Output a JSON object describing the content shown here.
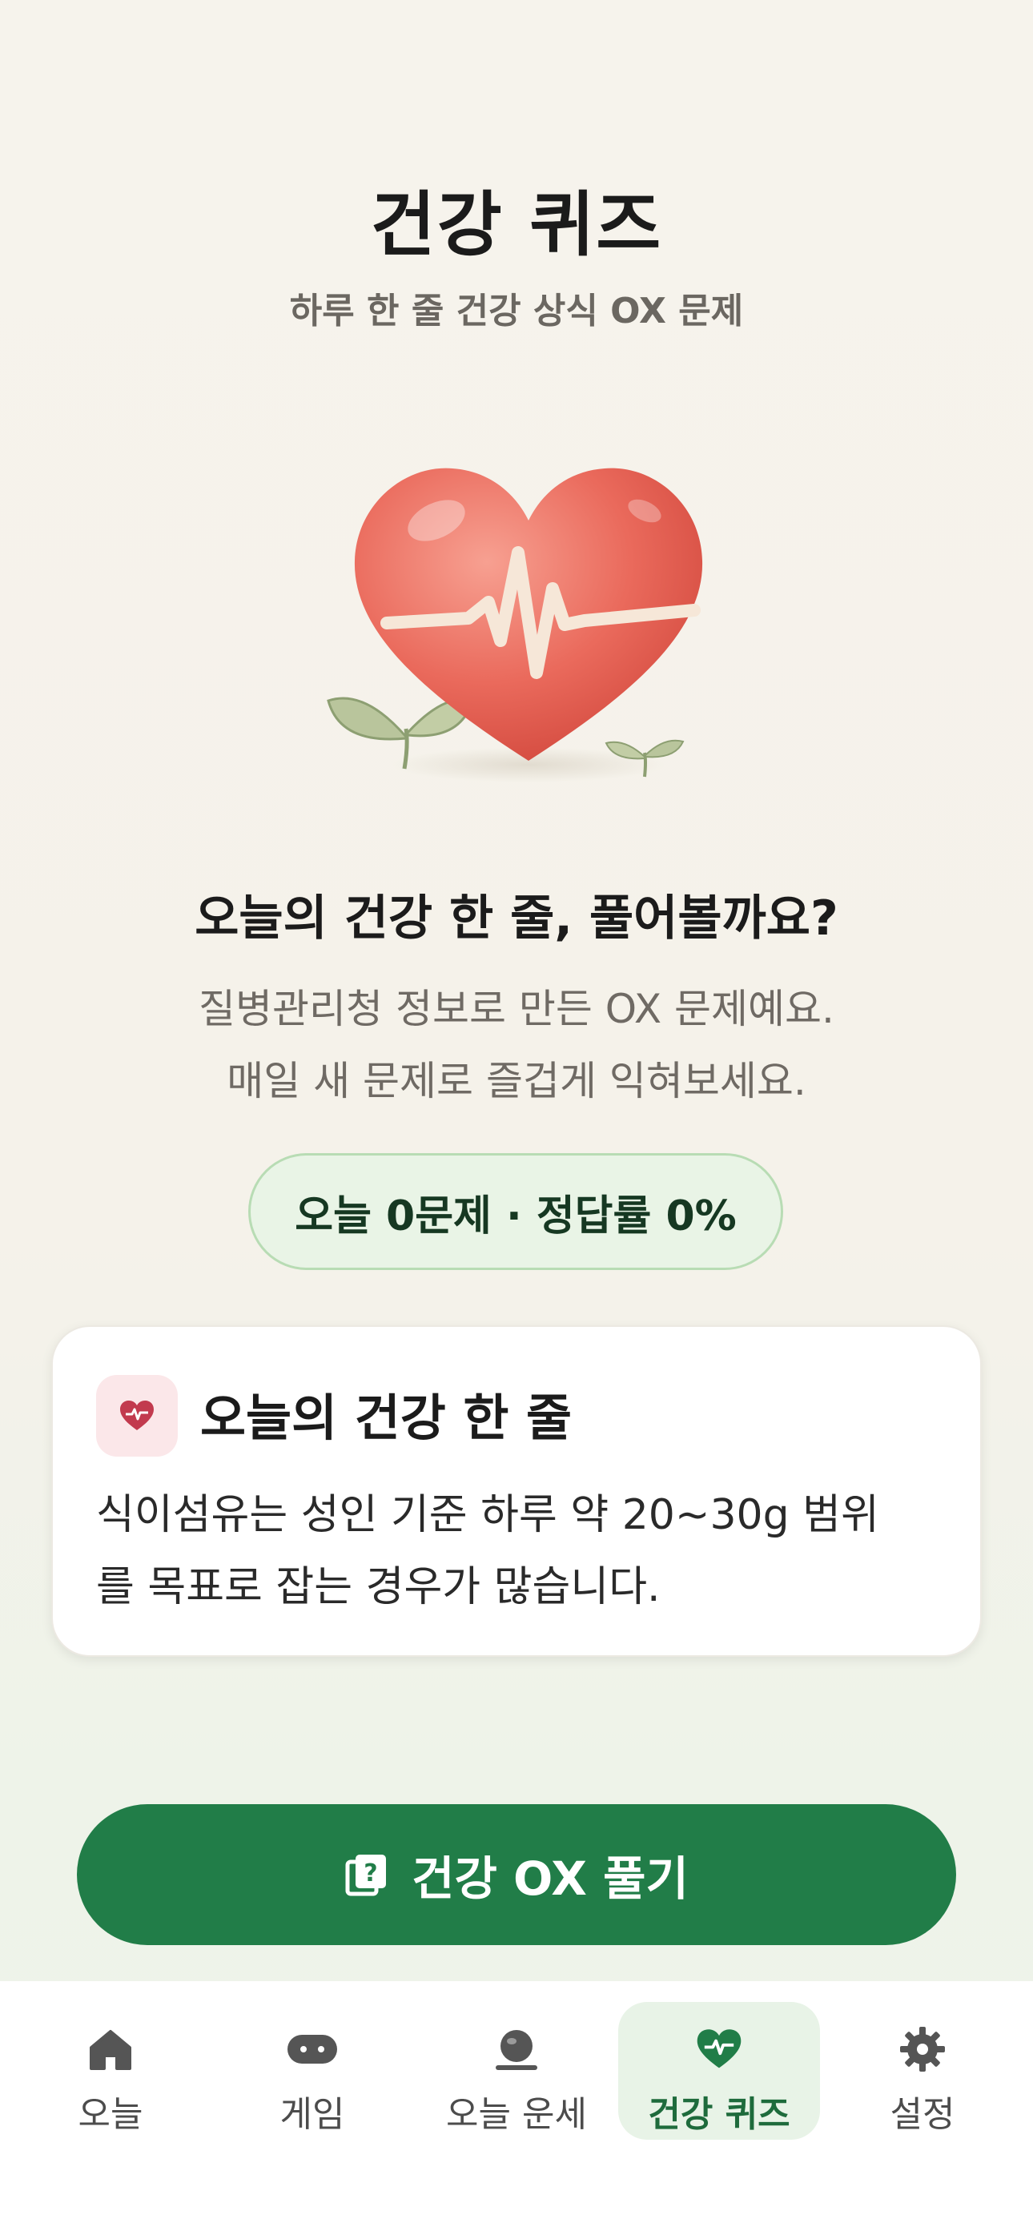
{
  "header": {
    "title": "건강 퀴즈",
    "subtitle": "하루 한 줄 건강 상식 OX 문제"
  },
  "hero": {
    "image": "heart-with-heartbeat-line-and-sprouts"
  },
  "intro": {
    "headline": "오늘의 건강 한 줄, 풀어볼까요?",
    "description_lines": [
      "질병관리청 정보로 만든 OX 문제예요.",
      "매일 새 문제로 즐겁게 익혀보세요."
    ]
  },
  "stats": {
    "text": "오늘 0문제 · 정답률 0%"
  },
  "tip_card": {
    "icon": "heart-pulse-icon",
    "title": "오늘의 건강 한 줄",
    "body_lines": [
      "식이섬유는 성인 기준 하루 약 20~30g 범위",
      "를 목표로 잡는 경우가 많습니다."
    ]
  },
  "cta": {
    "label": "건강 OX 풀기",
    "icon": "quiz-question-icon"
  },
  "tabs": [
    {
      "label": "오늘",
      "icon": "home-icon",
      "active": false
    },
    {
      "label": "게임",
      "icon": "gamepad-icon",
      "active": false
    },
    {
      "label": "오늘 운세",
      "icon": "fortune-icon",
      "active": false
    },
    {
      "label": "건강 퀴즈",
      "icon": "heart-pulse-icon",
      "active": true
    },
    {
      "label": "설정",
      "icon": "gear-icon",
      "active": false
    }
  ],
  "colors": {
    "background": "#f6f3ec",
    "accent_green": "#217d48",
    "active_tab_bg": "#e8f3e7",
    "heart_red": "#ea6a5c"
  }
}
